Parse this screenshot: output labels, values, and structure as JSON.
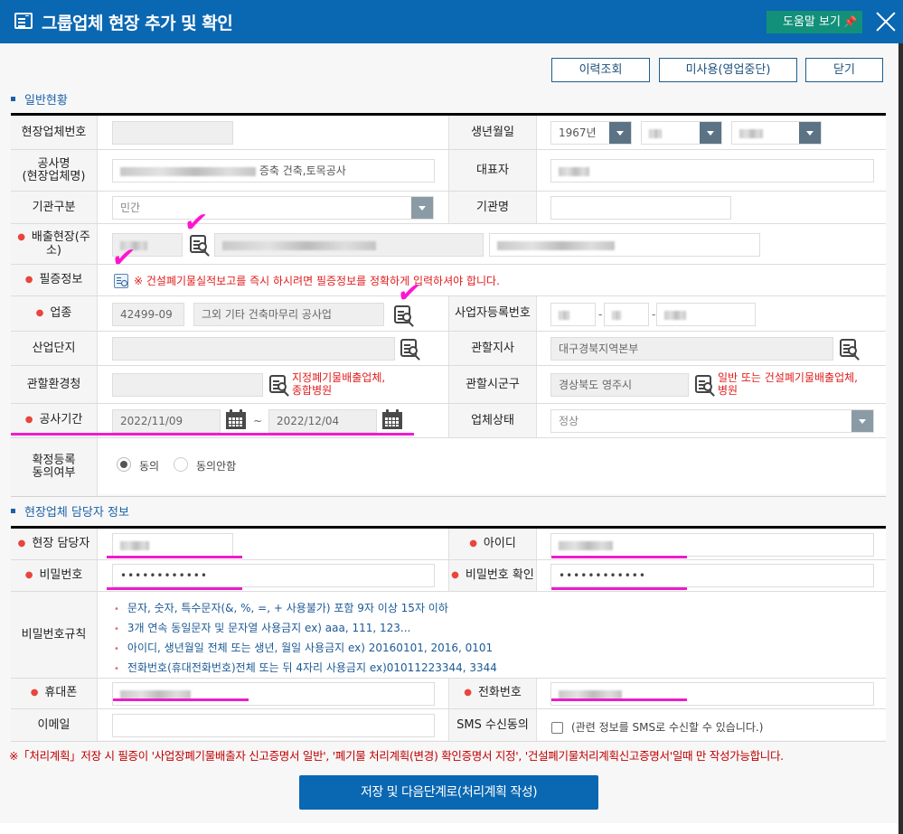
{
  "header": {
    "title": "그룹업체 현장 추가 및 확인",
    "help_label": "도움말 보기",
    "help_icon": "pin-icon",
    "close_icon": "close-icon"
  },
  "toolbar": {
    "history_label": "이력조회",
    "disable_label": "미사용(영업중단)",
    "close_label": "닫기"
  },
  "section_general": {
    "title": "일반현황",
    "site_no": {
      "label": "현장업체번호",
      "value": ""
    },
    "birth": {
      "label": "생년월일",
      "year": "1967년",
      "month": "",
      "day": ""
    },
    "project_name": {
      "label": "공사명\n(현장업체명)",
      "label_line1": "공사명",
      "label_line2": "(현장업체명)",
      "value_suffix": "증축 건축,토목공사"
    },
    "representative": {
      "label": "대표자",
      "value": ""
    },
    "org_type": {
      "label": "기관구분",
      "value": "민간"
    },
    "org_name": {
      "label": "기관명",
      "value": ""
    },
    "emission_site": {
      "label_line1": "배출현장(주",
      "label_line2": "소)",
      "zip": "",
      "address": "",
      "address_detail": ""
    },
    "required_info": {
      "label": "필증정보",
      "note": "※ 건설폐기물실적보고를 즉시 하시려면 필증정보를 정확하게 입력하셔야 합니다."
    },
    "industry": {
      "label": "업종",
      "code": "42499-09",
      "name": "그외 기타 건축마무리 공사업"
    },
    "biz_reg_no": {
      "label": "사업자등록번호",
      "part1": "",
      "part2": "",
      "part3": "",
      "separator": "-"
    },
    "industrial_complex": {
      "label": "산업단지",
      "value": ""
    },
    "branch": {
      "label": "관할지사",
      "value": "대구경북지역본부"
    },
    "env_office": {
      "label": "관할환경청",
      "value": "",
      "note_line1": "지정폐기물배출업체,",
      "note_line2": "종합병원"
    },
    "district": {
      "label": "관할시군구",
      "value": "경상북도 영주시",
      "note_line1": "일반 또는 건설폐기물배출업체,",
      "note_line2": "병원"
    },
    "period": {
      "label": "공사기간",
      "start": "2022/11/09",
      "tilde": "~",
      "end": "2022/12/04"
    },
    "status": {
      "label": "업체상태",
      "value": "정상"
    },
    "consent": {
      "label_line1": "확정등록",
      "label_line2": "동의여부",
      "options": [
        {
          "label": "동의",
          "selected": true
        },
        {
          "label": "동의안함",
          "selected": false
        }
      ]
    }
  },
  "section_contact": {
    "title": "현장업체 담당자 정보",
    "manager": {
      "label": "현장 담당자",
      "value": ""
    },
    "user_id": {
      "label": "아이디",
      "value": ""
    },
    "password": {
      "label": "비밀번호",
      "value": "••••••••••••"
    },
    "password_confirm": {
      "label": "비밀번호 확인",
      "value": "••••••••••••"
    },
    "password_rules": {
      "label": "비밀번호규칙",
      "items": [
        "문자, 숫자, 특수문자(&, %, =, + 사용불가) 포함 9자 이상 15자 이하",
        "3개 연속 동일문자 및 문자열 사용금지 ex) aaa, 111, 123...",
        "아이디, 생년월일 전체 또는 생년, 월일 사용금지 ex) 20160101, 2016, 0101",
        "전화번호(휴대전화번호)전체 또는 뒤 4자리 사용금지 ex)01011223344, 3344"
      ]
    },
    "mobile": {
      "label": "휴대폰",
      "value": ""
    },
    "phone": {
      "label": "전화번호",
      "value": ""
    },
    "email": {
      "label": "이메일",
      "value": ""
    },
    "sms": {
      "label": "SMS 수신동의",
      "checked": false,
      "text": "(관련 정보를 SMS로 수신할 수 있습니다.)"
    }
  },
  "footer": {
    "note": "※「처리계획」저장 시 필증이 '사업장폐기물배출자 신고증명서 일반', '폐기물 처리계획(변경) 확인증명서 지정', '건설폐기물처리계획신고증명서'일때 만 작성가능합니다.",
    "save_label": "저장 및 다음단계로(처리계획 작성)"
  },
  "annotations": {
    "check_mark": "✔",
    "color": "#ee1ccb"
  },
  "colors": {
    "header_bg": "#0a67b2",
    "help_btn": "#13907a",
    "required_dot": "#e8453c",
    "note_red": "#e11c1c",
    "rule_text": "#1c5a96"
  }
}
